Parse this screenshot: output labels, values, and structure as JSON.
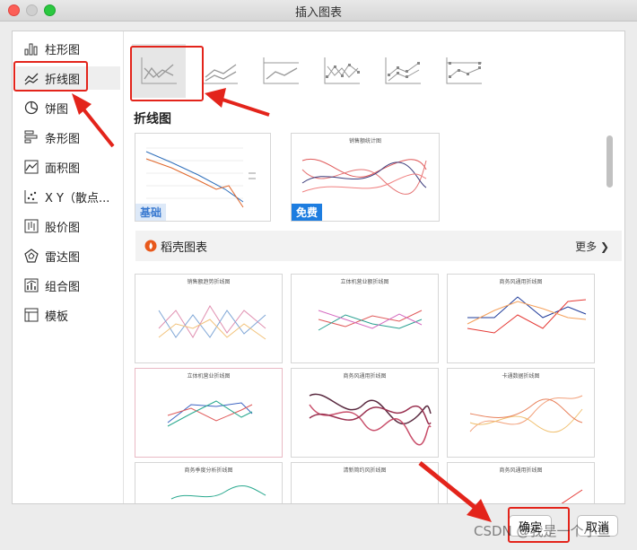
{
  "window": {
    "title": "插入图表"
  },
  "sidebar": {
    "items": [
      {
        "label": "柱形图",
        "icon": "bar-chart-icon"
      },
      {
        "label": "折线图",
        "icon": "line-chart-icon"
      },
      {
        "label": "饼图",
        "icon": "pie-chart-icon"
      },
      {
        "label": "条形图",
        "icon": "horizontal-bar-chart-icon"
      },
      {
        "label": "面积图",
        "icon": "area-chart-icon"
      },
      {
        "label": "X Y（散点...",
        "icon": "scatter-chart-icon"
      },
      {
        "label": "股价图",
        "icon": "stock-chart-icon"
      },
      {
        "label": "雷达图",
        "icon": "radar-chart-icon"
      },
      {
        "label": "组合图",
        "icon": "combo-chart-icon"
      },
      {
        "label": "模板",
        "icon": "template-icon"
      }
    ],
    "selected": "折线图"
  },
  "main": {
    "section_title": "折线图",
    "templates": [
      {
        "badge": "基础"
      },
      {
        "badge": "免费",
        "title": "销售额统计图"
      }
    ],
    "docer": {
      "title": "稻壳图表",
      "more": "更多"
    },
    "docer_cards": [
      {
        "title": "销售额趋势折线图"
      },
      {
        "title": "立体机营业额折线图"
      },
      {
        "title": "商务风通用折线图"
      },
      {
        "title": "立体机营业折线图"
      },
      {
        "title": "商务风通用折线图"
      },
      {
        "title": "卡通数据折线图"
      },
      {
        "title": "商务季度分析折线图"
      },
      {
        "title": "清新简约风折线图"
      },
      {
        "title": "商务风通用折线图"
      }
    ]
  },
  "footer": {
    "ok_label": "确定",
    "cancel_label": "取消"
  },
  "watermark": "CSDN @我是一个小鱼",
  "colors": {
    "highlight": "#e3241b",
    "badge_blue": "#1d7de0"
  }
}
